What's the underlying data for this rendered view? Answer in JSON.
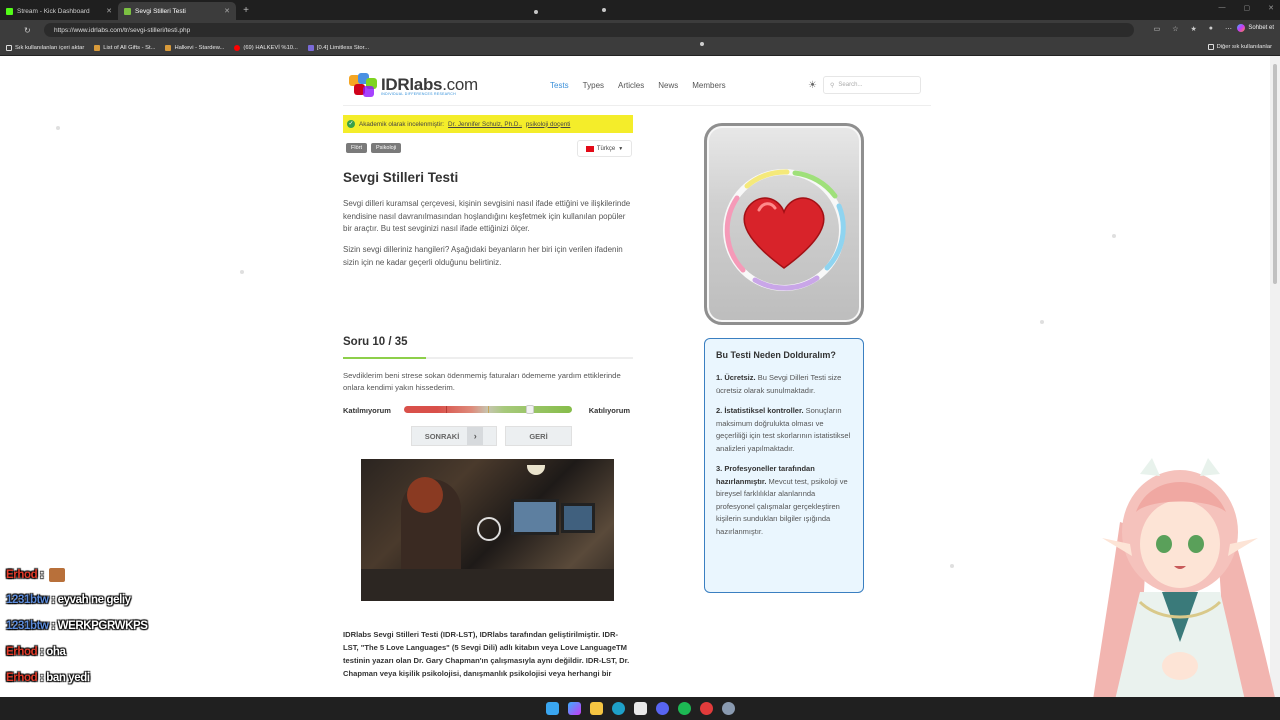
{
  "browser": {
    "tabs": [
      {
        "title": "Stream - Kick Dashboard",
        "icon": "kick-icon",
        "color": "#53fc18"
      },
      {
        "title": "Sevgi Stilleri Testi",
        "icon": "idrlabs-icon",
        "color": "#7cc142"
      }
    ],
    "url": "https://www.idrlabs.com/tr/sevgi-stilleri/testi.php",
    "chat_button": "Sohbet et",
    "bookmarks": [
      "Sık kullanılanları içeri aktar",
      "List of All Gifts - St...",
      "Halkevi - Stardew...",
      "(69) HALKEVİ %10...",
      "[0.4] Limitless Stor..."
    ],
    "other_bookmarks": "Diğer sık kullanılanlar"
  },
  "site": {
    "logo_main": "IDRlabs",
    "logo_ext": ".com",
    "logo_sub": "INDIVIDUAL DIFFERENCES RESEARCH",
    "nav": [
      "Tests",
      "Types",
      "Articles",
      "News",
      "Members"
    ],
    "search_placeholder": "Search..."
  },
  "academic": {
    "prefix": "Akademik olarak incelenmiştir:",
    "reviewer": "Dr. Jennifer Schulz, Ph.D.,",
    "role": "psikoloji doçenti"
  },
  "tags": [
    "Flört",
    "Psikoloji"
  ],
  "language": "Türkçe",
  "title": "Sevgi Stilleri Testi",
  "intro1": "Sevgi dilleri kuramsal çerçevesi, kişinin sevgisini nasıl ifade ettiğini ve ilişkilerinde kendisine nasıl davranılmasından hoşlandığını keşfetmek için kullanılan popüler bir araçtır. Bu test sevginizi nasıl ifade ettiğinizi ölçer.",
  "intro2": "Sizin sevgi dilleriniz hangileri? Aşağıdaki beyanların her biri için verilen ifadenin sizin için ne kadar geçerli olduğunu belirtiniz.",
  "question": {
    "label": "Soru 10 / 35",
    "progress": 0.286,
    "text": "Sevdiklerim beni strese sokan ödenmemiş faturaları ödememe yardım ettiklerinde onlara kendimi yakın hissederim.",
    "left_label": "Katılmıyorum",
    "right_label": "Katılıyorum",
    "scale_value": 0.75,
    "next": "SONRAKİ",
    "back": "GERİ"
  },
  "bottom_text": "IDRlabs Sevgi Stilleri Testi (IDR-LST), IDRlabs tarafından geliştirilmiştir. IDR-LST, \"The 5 Love Languages\" (5 Sevgi Dili) adlı kitabın veya Love LanguageTM testinin yazarı olan Dr. Gary Chapman'ın çalışmasıyla aynı değildir. IDR-LST, Dr. Chapman veya kişilik psikolojisi, danışmanlık psikolojisi veya herhangi bir",
  "why": {
    "title": "Bu Testi Neden Dolduralım?",
    "items": [
      {
        "bold": "1. Ücretsiz.",
        "text": " Bu Sevgi Dilleri Testi size ücretsiz olarak sunulmaktadır."
      },
      {
        "bold": "2. İstatistiksel kontroller.",
        "text": " Sonuçların maksimum doğrulukta olması ve geçerliliği için test skorlarının istatistiksel analizleri yapılmaktadır."
      },
      {
        "bold": "3. Profesyoneller tarafından hazırlanmıştır.",
        "text": " Mevcut test, psikoloji ve bireysel farklılıklar alanlarında profesyonel çalışmalar gerçekleştiren kişilerin sundukları bilgiler ışığında hazırlanmıştır."
      }
    ]
  },
  "chat": [
    {
      "user": "Erhod",
      "msg": "",
      "emote": true
    },
    {
      "user": "1231btw",
      "msg": "eyvah ne geliy",
      "emote": false
    },
    {
      "user": "1231btw",
      "msg": "WERKPGRWKPS",
      "emote": false
    },
    {
      "user": "Erhod",
      "msg": "oha",
      "emote": false
    },
    {
      "user": "Erhod",
      "msg": "ban yedi",
      "emote": false
    },
    {
      "user": "Erhod",
      "msg": "",
      "emote": true
    }
  ]
}
